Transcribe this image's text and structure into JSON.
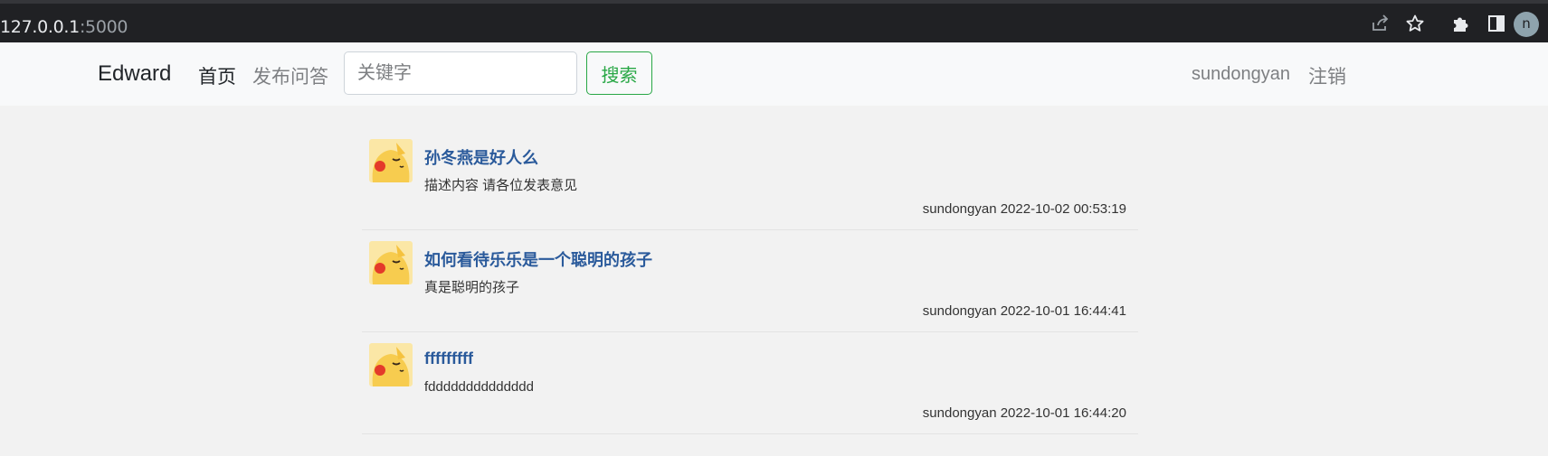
{
  "browser": {
    "url_host": "127.0.0.1",
    "url_port": ":5000",
    "profile_initial": "n"
  },
  "navbar": {
    "brand": "Edward",
    "home_label": "首页",
    "post_label": "发布问答",
    "search_placeholder": "关键字",
    "search_button": "搜索",
    "username": "sundongyan",
    "logout_label": "注销"
  },
  "colors": {
    "accent_green": "#28a745",
    "title_blue": "#2a5a9b",
    "navbar_bg": "#f8f9fa",
    "page_bg": "#f2f2f2"
  },
  "questions": [
    {
      "title": "孙冬燕是好人么",
      "description": "描述内容 请各位发表意见",
      "meta": "sundongyan 2022-10-02 00:53:19",
      "avatar": "pikachu-avatar"
    },
    {
      "title": "如何看待乐乐是一个聪明的孩子",
      "description": "真是聪明的孩子",
      "meta": "sundongyan 2022-10-01 16:44:41",
      "avatar": "pikachu-avatar"
    },
    {
      "title": "fffffffff",
      "description": "fdddddddddddddd",
      "meta": "sundongyan 2022-10-01 16:44:20",
      "avatar": "pikachu-avatar"
    }
  ]
}
